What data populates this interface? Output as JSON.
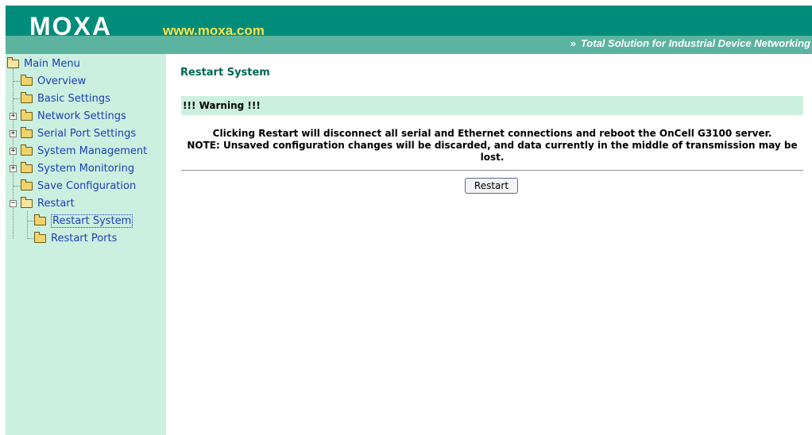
{
  "header": {
    "logo": "MOXA",
    "url": "www.moxa.com",
    "tagline_prefix": "»",
    "tagline": "Total Solution for Industrial Device Networking"
  },
  "sidebar": {
    "root": "Main Menu",
    "items": [
      {
        "label": "Overview"
      },
      {
        "label": "Basic Settings"
      },
      {
        "label": "Network Settings",
        "expander": "+"
      },
      {
        "label": "Serial Port Settings",
        "expander": "+"
      },
      {
        "label": "System Management",
        "expander": "+"
      },
      {
        "label": "System Monitoring",
        "expander": "+"
      },
      {
        "label": "Save Configuration"
      },
      {
        "label": "Restart",
        "expander": "−"
      },
      {
        "label": "Restart System",
        "selected": true
      },
      {
        "label": "Restart Ports"
      }
    ]
  },
  "main": {
    "title": "Restart System",
    "warning": "!!! Warning !!!",
    "message_line1": "Clicking Restart will disconnect all serial and Ethernet connections and reboot the OnCell G3100 server.",
    "message_line2": "NOTE: Unsaved configuration changes will be discarded, and data currently in the middle of transmission may be lost.",
    "restart_button": "Restart"
  },
  "colors": {
    "header_bg": "#008c7a",
    "header_strip": "#5cb39f",
    "url_color": "#ffe24a",
    "sidebar_bg": "#ccf0e0",
    "link_color": "#1a3fb8",
    "title_color": "#00674f"
  }
}
